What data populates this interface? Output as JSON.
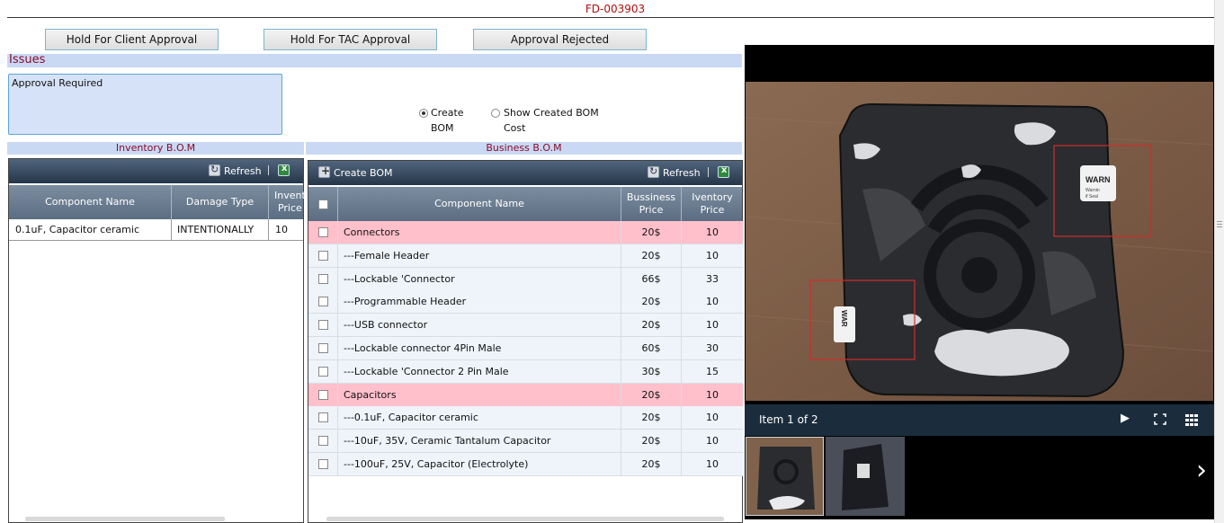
{
  "header": {
    "record_id": "FD-003903"
  },
  "actions": {
    "hold_client": "Hold For Client Approval",
    "hold_tac": "Hold For TAC Approval",
    "rejected": "Approval Rejected"
  },
  "issues": {
    "title": "Issues",
    "text": "Approval Required"
  },
  "bom_mode": {
    "selected": "create",
    "create_label_line1": "Create",
    "create_label_line2": "BOM",
    "show_label_line1": "Show Created BOM",
    "show_label_line2": "Cost"
  },
  "inventory_bom": {
    "title": "Inventory B.O.M",
    "refresh_label": "Refresh",
    "columns": {
      "component": "Component Name",
      "damage": "Damage Type",
      "price_line1": "Invent",
      "price_line2": "Price"
    },
    "rows": [
      {
        "component": "0.1uF, Capacitor ceramic",
        "damage": "INTENTIONALLY",
        "price": "10"
      }
    ]
  },
  "business_bom": {
    "title": "Business B.O.M",
    "create_label": "Create BOM",
    "refresh_label": "Refresh",
    "columns": {
      "component": "Component Name",
      "bprice_line1": "Bussiness",
      "bprice_line2": "Price",
      "iprice_line1": "Iventory",
      "iprice_line2": "Price"
    },
    "rows": [
      {
        "name": "Connectors",
        "bprice": "20$",
        "iprice": "10",
        "group": true
      },
      {
        "name": "---Female Header",
        "bprice": "20$",
        "iprice": "10",
        "group": false
      },
      {
        "name": "---Lockable 'Connector",
        "bprice": "66$",
        "iprice": "33",
        "group": false
      },
      {
        "name": "---Programmable Header",
        "bprice": "20$",
        "iprice": "10",
        "group": false
      },
      {
        "name": "---USB connector",
        "bprice": "20$",
        "iprice": "10",
        "group": false
      },
      {
        "name": "---Lockable connector 4Pin Male",
        "bprice": "60$",
        "iprice": "30",
        "group": false
      },
      {
        "name": "---Lockable 'Connector 2 Pin Male",
        "bprice": "30$",
        "iprice": "15",
        "group": false
      },
      {
        "name": "Capacitors",
        "bprice": "20$",
        "iprice": "10",
        "group": true
      },
      {
        "name": "---0.1uF, Capacitor ceramic",
        "bprice": "20$",
        "iprice": "10",
        "group": false
      },
      {
        "name": "---10uF, 35V, Ceramic Tantalum Capacitor",
        "bprice": "20$",
        "iprice": "10",
        "group": false
      },
      {
        "name": "---100uF, 25V, Capacitor (Electrolyte)",
        "bprice": "20$",
        "iprice": "10",
        "group": false
      }
    ]
  },
  "viewer": {
    "caption": "Item 1 of 2",
    "label_warn_1": "WARN",
    "label_warn_2": "WAR",
    "label_small_1": "Warnin",
    "label_small_2": "if Seal"
  }
}
